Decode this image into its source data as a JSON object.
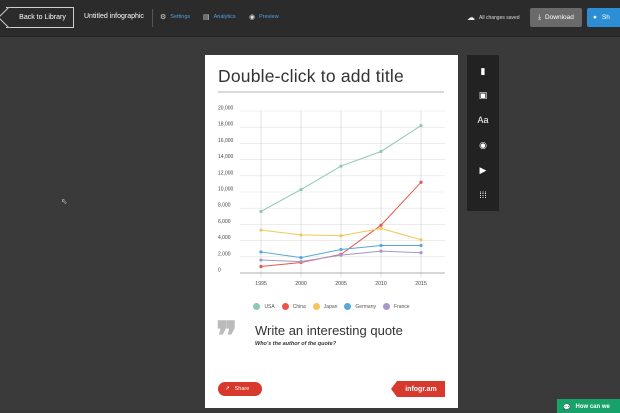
{
  "topbar": {
    "back_label": "Back to Library",
    "doc_title": "Untitled infographic",
    "settings_label": "Settings",
    "analytics_label": "Analytics",
    "preview_label": "Preview",
    "saved_status": "All changes saved",
    "download_label": "Download",
    "share_label": "Sh"
  },
  "card": {
    "title": "Double-click to add title",
    "quote": "Write an interesting quote",
    "quote_author": "Who's the author of the quote?",
    "share_label": "Share",
    "brand": "infogr.am"
  },
  "chat": {
    "label": "How can we"
  },
  "toolbar": {
    "items": [
      {
        "name": "chart-icon",
        "glyph": "▮"
      },
      {
        "name": "map-icon",
        "glyph": "▣"
      },
      {
        "name": "text-icon",
        "glyph": "Aa"
      },
      {
        "name": "camera-icon",
        "glyph": "◉"
      },
      {
        "name": "video-icon",
        "glyph": "▶"
      },
      {
        "name": "grid-icon",
        "glyph": "⁞⁞⁞"
      }
    ]
  },
  "colors": {
    "USA": "#8dc9ae",
    "China": "#e5564d",
    "Japan": "#f5c75a",
    "Germany": "#57a8d9",
    "France": "#a598c8",
    "accent": "#d8392d"
  },
  "chart_data": {
    "type": "line",
    "x": [
      1995,
      2000,
      2005,
      2010,
      2015
    ],
    "ylim": [
      0,
      20000
    ],
    "yticks": [
      "20,000",
      "18,000",
      "16,000",
      "14,000",
      "12,000",
      "10,000",
      "8,000",
      "6,000",
      "4,000",
      "2,000",
      "0"
    ],
    "grid": true,
    "legend_position": "bottom",
    "series": [
      {
        "name": "USA",
        "values": [
          7600,
          10300,
          13200,
          15000,
          18200
        ]
      },
      {
        "name": "China",
        "values": [
          800,
          1300,
          2300,
          5900,
          11200
        ]
      },
      {
        "name": "Japan",
        "values": [
          5300,
          4700,
          4600,
          5500,
          4100
        ]
      },
      {
        "name": "Germany",
        "values": [
          2600,
          1900,
          2900,
          3400,
          3400
        ]
      },
      {
        "name": "France",
        "values": [
          1600,
          1400,
          2200,
          2700,
          2500
        ]
      }
    ]
  }
}
